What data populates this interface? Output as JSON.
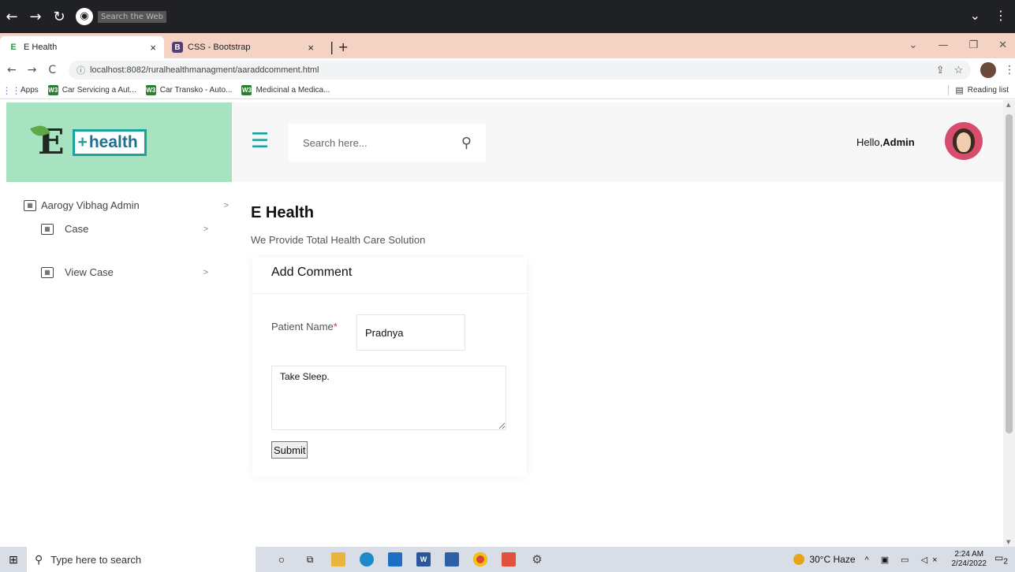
{
  "outer": {
    "search_placeholder": "Search the Web"
  },
  "tabs": [
    {
      "title": "E Health",
      "active": true
    },
    {
      "title": "CSS - Bootstrap",
      "active": false
    }
  ],
  "address": {
    "url": "localhost:8082/ruralhealthmanagment/aaraddcomment.html"
  },
  "bookmarks": [
    {
      "label": "Apps",
      "icon": "apps-grid-icon"
    },
    {
      "label": "Car Servicing a Aut...",
      "icon": "w3-icon"
    },
    {
      "label": "Car Transko - Auto...",
      "icon": "w3-icon"
    },
    {
      "label": "Medicinal a Medica...",
      "icon": "w3-icon"
    }
  ],
  "reading_list": "Reading list",
  "logo": {
    "letter": "E",
    "word": "health"
  },
  "header": {
    "search_placeholder": "Search here...",
    "hello_prefix": "Hello,",
    "user": "Admin"
  },
  "sidebar": {
    "items": [
      {
        "label": "Aarogy Vibhag Admin"
      },
      {
        "label": "Case"
      },
      {
        "label": "View Case"
      }
    ]
  },
  "main": {
    "title": "E Health",
    "subtitle": "We Provide Total Health Care Solution"
  },
  "form": {
    "heading": "Add Comment",
    "patient_label": "Patient Name",
    "required_mark": "*",
    "patient_value": "Pradnya",
    "comment_value": "Take Sleep.",
    "submit_label": "Submit"
  },
  "taskbar": {
    "search_placeholder": "Type here to search",
    "weather": "30°C Haze",
    "time": "2:24 AM",
    "date": "2/24/2022",
    "notification_count": "2"
  },
  "colors": {
    "brand_teal": "#1aa29c",
    "logo_bg": "#a7e2c1",
    "tab_strip": "#f5d3c4",
    "required": "#e0343b"
  }
}
